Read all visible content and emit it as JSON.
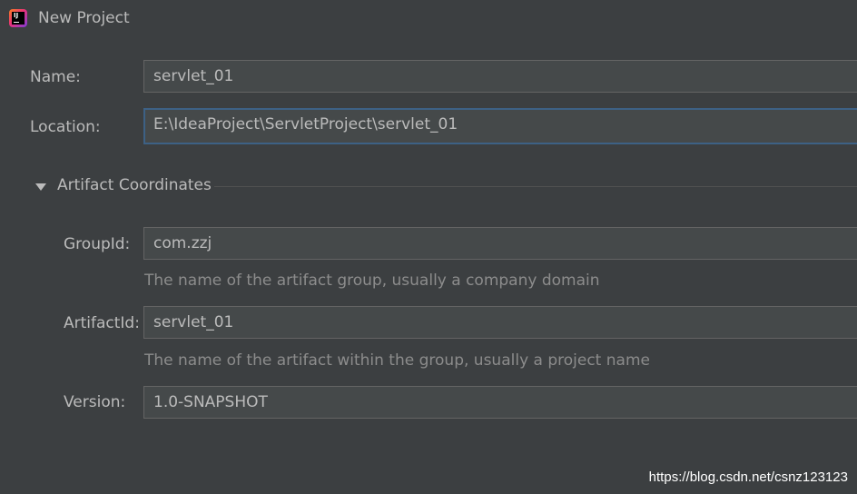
{
  "window": {
    "title": "New Project",
    "app_icon": "intellij-idea-icon",
    "app_icon_text": "IJ"
  },
  "form": {
    "name": {
      "label": "Name:",
      "value": "servlet_01"
    },
    "location": {
      "label": "Location:",
      "value": "E:\\IdeaProject\\ServletProject\\servlet_01"
    },
    "artifact_section": {
      "label": "Artifact Coordinates",
      "expanded": true,
      "group_id": {
        "label": "GroupId:",
        "value": "com.zzj",
        "hint": "The name of the artifact group, usually a company domain"
      },
      "artifact_id": {
        "label": "ArtifactId:",
        "value": "servlet_01",
        "hint": "The name of the artifact within the group, usually a project name"
      },
      "version": {
        "label": "Version:",
        "value": "1.0-SNAPSHOT"
      }
    }
  },
  "watermark": "https://blog.csdn.net/csnz123123",
  "colors": {
    "background": "#3c3f41",
    "field_background": "#45494a",
    "field_border": "#646464",
    "focus_border": "#3d6185",
    "text": "#bbbbbb",
    "hint_text": "#8c8c8c"
  }
}
